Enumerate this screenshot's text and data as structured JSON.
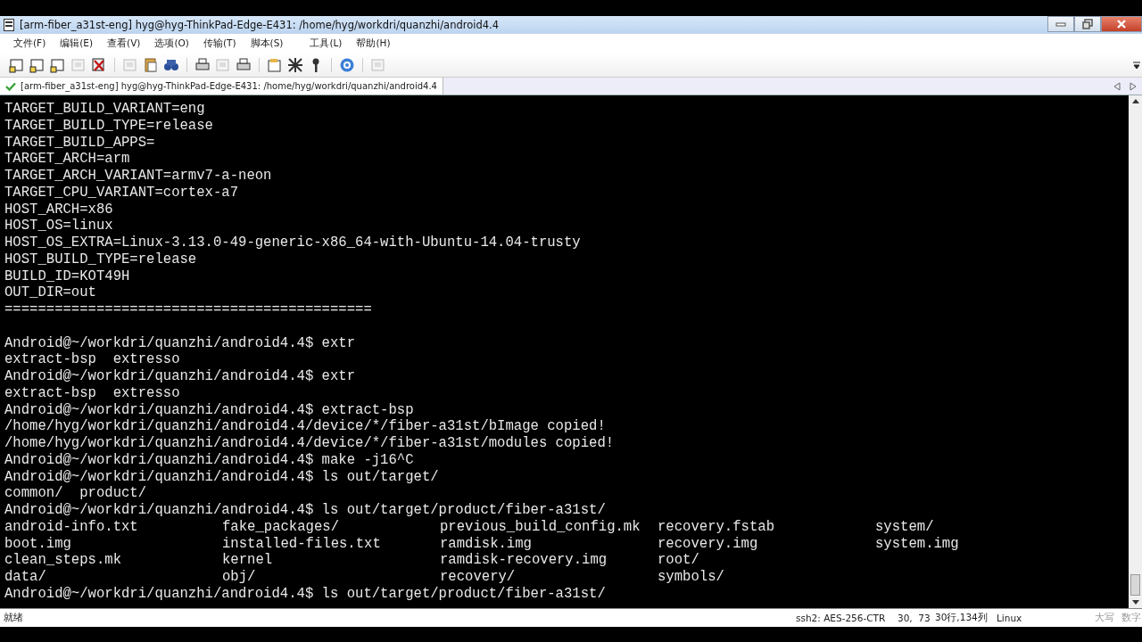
{
  "window": {
    "title": "[arm-fiber_a31st-eng] hyg@hyg-ThinkPad-Edge-E431: /home/hyg/workdri/quanzhi/android4.4"
  },
  "menu": [
    "文件(F)",
    "编辑(E)",
    "查看(V)",
    "选项(O)",
    "传输(T)",
    "脚本(S)",
    "工具(L)",
    "帮助(H)"
  ],
  "tabs": [
    {
      "label": "[arm-fiber_a31st-eng] hyg@hyg-ThinkPad-Edge-E431: /home/hyg/workdri/quanzhi/android4.4",
      "selected": true,
      "connected": true
    }
  ],
  "terminal": {
    "lines": [
      {
        "kind": "text",
        "text": "TARGET_BUILD_VARIANT=eng"
      },
      {
        "kind": "text",
        "text": "TARGET_BUILD_TYPE=release"
      },
      {
        "kind": "text",
        "text": "TARGET_BUILD_APPS="
      },
      {
        "kind": "text",
        "text": "TARGET_ARCH=arm"
      },
      {
        "kind": "text",
        "text": "TARGET_ARCH_VARIANT=armv7-a-neon"
      },
      {
        "kind": "text",
        "text": "TARGET_CPU_VARIANT=cortex-a7"
      },
      {
        "kind": "text",
        "text": "HOST_ARCH=x86"
      },
      {
        "kind": "text",
        "text": "HOST_OS=linux"
      },
      {
        "kind": "text",
        "text": "HOST_OS_EXTRA=Linux-3.13.0-49-generic-x86_64-with-Ubuntu-14.04-trusty"
      },
      {
        "kind": "text",
        "text": "HOST_BUILD_TYPE=release"
      },
      {
        "kind": "text",
        "text": "BUILD_ID=KOT49H"
      },
      {
        "kind": "text",
        "text": "OUT_DIR=out"
      },
      {
        "kind": "text",
        "text": "============================================"
      },
      {
        "kind": "blank"
      },
      {
        "kind": "text",
        "text": "Android@~/workdri/quanzhi/android4.4$ extr"
      },
      {
        "kind": "text",
        "text": "extract-bsp  extresso"
      },
      {
        "kind": "text",
        "text": "Android@~/workdri/quanzhi/android4.4$ extr"
      },
      {
        "kind": "text",
        "text": "extract-bsp  extresso"
      },
      {
        "kind": "text",
        "text": "Android@~/workdri/quanzhi/android4.4$ extract-bsp"
      },
      {
        "kind": "text",
        "text": "/home/hyg/workdri/quanzhi/android4.4/device/*/fiber-a31st/bImage copied!"
      },
      {
        "kind": "text",
        "text": "/home/hyg/workdri/quanzhi/android4.4/device/*/fiber-a31st/modules copied!"
      },
      {
        "kind": "text",
        "text": "Android@~/workdri/quanzhi/android4.4$ make -j16^C"
      },
      {
        "kind": "text",
        "text": "Android@~/workdri/quanzhi/android4.4$ ls out/target/"
      },
      {
        "kind": "text",
        "text": "common/  product/"
      },
      {
        "kind": "text",
        "text": "Android@~/workdri/quanzhi/android4.4$ ls out/target/product/fiber-a31st/"
      },
      {
        "kind": "columns",
        "cells": [
          "android-info.txt",
          "fake_packages/",
          "previous_build_config.mk",
          "recovery.fstab",
          "system/"
        ]
      },
      {
        "kind": "columns",
        "cells": [
          "boot.img",
          "installed-files.txt",
          "ramdisk.img",
          "recovery.img",
          "system.img"
        ]
      },
      {
        "kind": "columns",
        "cells": [
          "clean_steps.mk",
          "kernel",
          "ramdisk-recovery.img",
          "root/"
        ]
      },
      {
        "kind": "columns",
        "cells": [
          "data/",
          "obj/",
          "recovery/",
          "symbols/"
        ]
      },
      {
        "kind": "text",
        "text": "Android@~/workdri/quanzhi/android4.4$ ls out/target/product/fiber-a31st/"
      }
    ]
  },
  "status_bar": [
    {
      "text": "就绪",
      "disabled": false
    },
    {
      "text": "ssh2: AES-256-CTR",
      "disabled": false
    },
    {
      "text": "30,  73",
      "disabled": false
    },
    {
      "text": "30行,134列",
      "disabled": false
    },
    {
      "text": "Linux",
      "disabled": false
    },
    {
      "text": "大写",
      "disabled": true
    },
    {
      "text": "数字",
      "disabled": true
    }
  ]
}
